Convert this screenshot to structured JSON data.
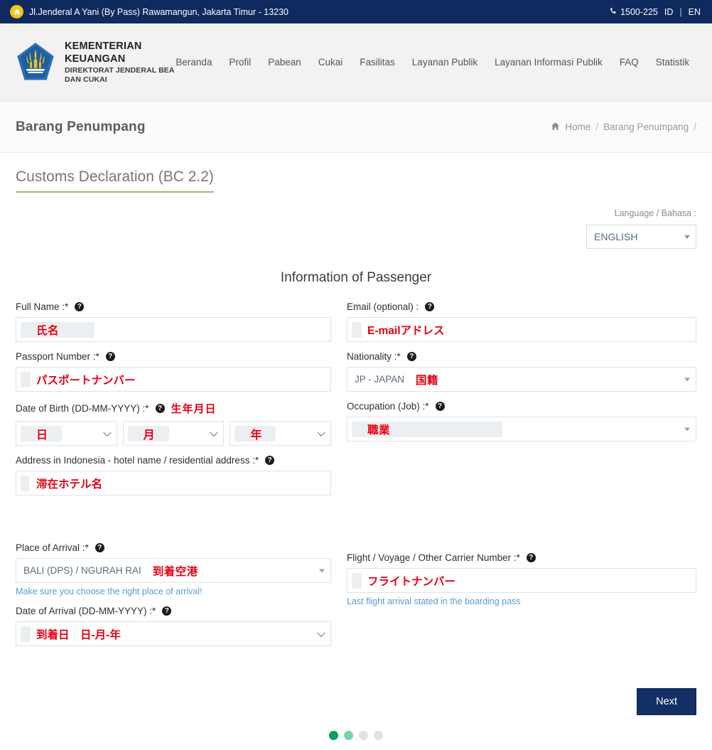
{
  "topbar": {
    "home_icon": "home-icon",
    "address": "Jl.Jenderal A Yani (By Pass) Rawamangun, Jakarta Timur - 13230",
    "phone_icon": "phone-icon",
    "phone": "1500-225",
    "lang_id": "ID",
    "lang_separator": "|",
    "lang_en": "EN"
  },
  "header": {
    "logo_icon": "ministry-of-finance-logo",
    "brand_primary": "KEMENTERIAN KEUANGAN",
    "brand_secondary": "DIREKTORAT JENDERAL BEA DAN CUKAI",
    "nav": [
      {
        "label": "Beranda"
      },
      {
        "label": "Profil"
      },
      {
        "label": "Pabean"
      },
      {
        "label": "Cukai"
      },
      {
        "label": "Fasilitas"
      },
      {
        "label": "Layanan Publik"
      },
      {
        "label": "Layanan Informasi Publik"
      },
      {
        "label": "FAQ"
      },
      {
        "label": "Statistik"
      }
    ]
  },
  "pagehead": {
    "title": "Barang Penumpang",
    "breadcrumb": {
      "home_icon": "home-icon",
      "home": "Home",
      "sep1": "/",
      "current": "Barang Penumpang",
      "sep2": "/"
    }
  },
  "form": {
    "card_title": "Customs Declaration (BC 2.2)",
    "language_label": "Language / Bahasa :",
    "language_value": "ENGLISH",
    "section_title": "Information of Passenger",
    "fields": {
      "full_name": {
        "label": "Full Name :*",
        "jp_value": "氏名"
      },
      "email": {
        "label": "Email (optional) :",
        "jp_value": "E-mailアドレス"
      },
      "passport": {
        "label": "Passport Number :*",
        "jp_value": "パスポートナンバー"
      },
      "nationality": {
        "label": "Nationality :*",
        "value": "JP - JAPAN",
        "jp_value": "国籍"
      },
      "dob": {
        "label": "Date of Birth (DD-MM-YYYY) :*",
        "jp_label": "生年月日",
        "day": "日",
        "month": "月",
        "year": "年"
      },
      "occupation": {
        "label": "Occupation (Job) :*",
        "jp_value": "職業"
      },
      "address": {
        "label": "Address in Indonesia - hotel name / residential address :*",
        "jp_value": "滞在ホテル名"
      },
      "place_of_arrival": {
        "label": "Place of Arrival :*",
        "value": "BALI (DPS) / NGURAH RAI",
        "jp_value": "到着空港",
        "help": "Make sure you choose the right place of arrival!"
      },
      "flight_number": {
        "label": "Flight / Voyage / Other Carrier Number :*",
        "jp_value": "フライトナンバー",
        "help": "Last flight arrival stated in the boarding pass"
      },
      "date_of_arrival": {
        "label": "Date of Arrival (DD-MM-YYYY) :*",
        "jp_value": "到着日　日-月-年"
      }
    },
    "next_button": "Next",
    "pagination": {
      "dots": [
        "#0aa05a",
        "#79d3a9",
        "#e2e2e2",
        "#e2e2e2"
      ]
    }
  },
  "colors": {
    "navy": "#0f2a5e",
    "accent_red": "#e60012",
    "green_underline": "#8fc268",
    "help_blue": "#5b9bd5"
  }
}
